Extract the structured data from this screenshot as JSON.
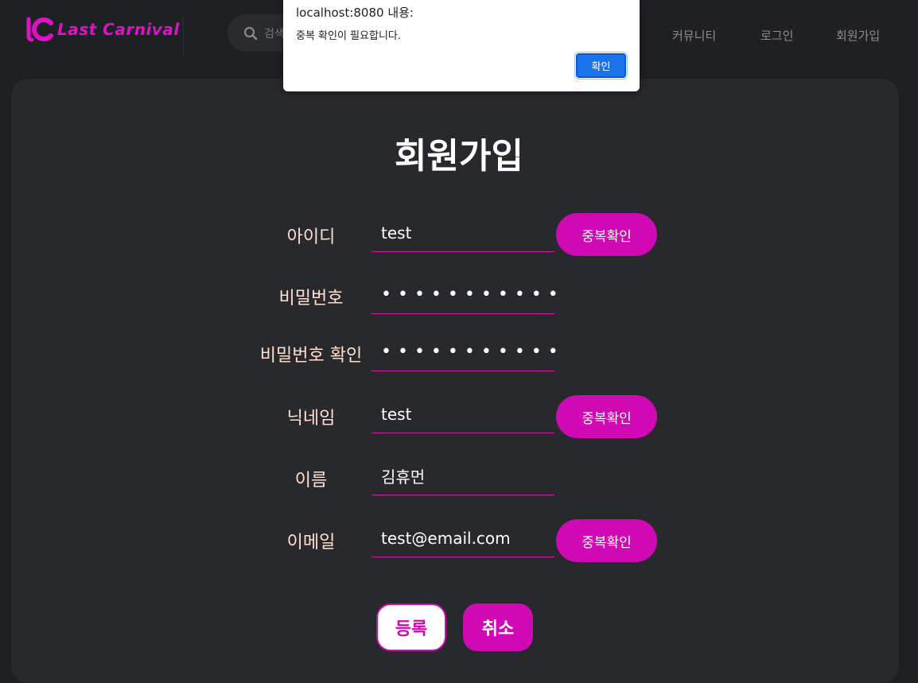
{
  "header": {
    "logo_text": "Last Carnival",
    "search_placeholder": "검색",
    "nav": {
      "community": "커뮤니티",
      "login": "로그인",
      "signup": "회원가입"
    }
  },
  "form": {
    "title": "회원가입",
    "fields": [
      {
        "label": "아이디",
        "value": "test"
      },
      {
        "label": "비밀번호",
        "value": "•••••••••••"
      },
      {
        "label": "비밀번호 확인",
        "value": "•••••••••••"
      },
      {
        "label": "닉네임",
        "value": "test"
      },
      {
        "label": "이름",
        "value": "김휴먼"
      },
      {
        "label": "이메일",
        "value": "test@email.com"
      }
    ],
    "dup_check_label": "중복확인",
    "submit_label": "등록",
    "cancel_label": "취소"
  },
  "dialog": {
    "title": "localhost:8080 내용:",
    "message": "중복 확인이 필요합니다.",
    "ok_label": "확인"
  },
  "colors": {
    "accent": "#d009b5",
    "background": "#1f2023",
    "card": "#28292c",
    "dialog_button": "#1a73e8"
  }
}
